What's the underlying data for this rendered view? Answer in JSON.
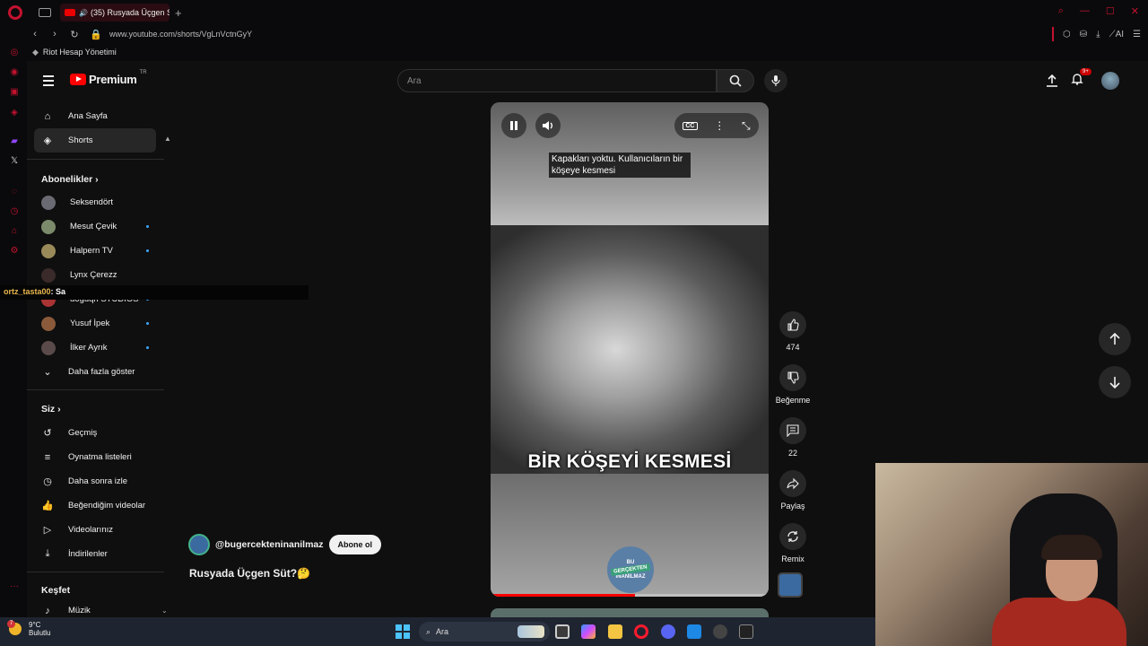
{
  "browser": {
    "tab_title": "(35) Rusyada Üçgen S",
    "url": "www.youtube.com/shorts/VgLnVctnGyY",
    "bookmark": "Riot Hesap Yönetimi",
    "ai_label": "AI"
  },
  "youtube": {
    "logo_text": "Premium",
    "logo_country": "TR",
    "search_placeholder": "Ara",
    "notification_count": "9+"
  },
  "sidebar": {
    "main": [
      {
        "label": "Ana Sayfa",
        "icon": "home-icon"
      },
      {
        "label": "Shorts",
        "icon": "shorts-icon",
        "active": true
      }
    ],
    "subscriptions_title": "Abonelikler",
    "subscriptions": [
      {
        "label": "Seksendört",
        "new": false
      },
      {
        "label": "Mesut Çevik",
        "new": true
      },
      {
        "label": "Halpern TV",
        "new": true
      },
      {
        "label": "Lynx Çerezz",
        "new": false
      },
      {
        "label": "doguqn STUDIOS",
        "new": true
      },
      {
        "label": "Yusuf İpek",
        "new": true
      },
      {
        "label": "İlker Ayrık",
        "new": true
      }
    ],
    "show_more": "Daha fazla göster",
    "you_title": "Siz",
    "you_items": [
      {
        "label": "Geçmiş",
        "icon": "history-icon"
      },
      {
        "label": "Oynatma listeleri",
        "icon": "playlist-icon"
      },
      {
        "label": "Daha sonra izle",
        "icon": "clock-icon"
      },
      {
        "label": "Beğendiğim videolar",
        "icon": "thumbs-up-icon"
      },
      {
        "label": "Videolarınız",
        "icon": "video-icon"
      },
      {
        "label": "İndirilenler",
        "icon": "download-icon"
      }
    ],
    "explore_title": "Keşfet",
    "explore_items": [
      {
        "label": "Müzik",
        "icon": "music-icon"
      }
    ]
  },
  "chat_overlay": {
    "user": "ortz_tasta00",
    "message": ": Sa"
  },
  "short": {
    "caption": "Kapakları yoktu. Kullanıcıların bir köşeye kesmesi",
    "big_subtitle": "BİR KÖŞEYİ KESMESİ",
    "watermark_top": "BU",
    "watermark_mid": "GERÇEKTEN",
    "watermark_bottom": "İNANILMAZ",
    "progress": 0.52,
    "channel_handle": "@bugercekteninanilmaz",
    "subscribe_label": "Abone ol",
    "title": "Rusyada Üçgen Süt?🤔",
    "cc_label": "CC"
  },
  "actions": {
    "likes": "474",
    "dislike_label": "Beğenme",
    "comments": "22",
    "share_label": "Paylaş",
    "remix_label": "Remix"
  },
  "taskbar": {
    "temperature": "9°C",
    "weather": "Bulutlu",
    "weather_alert": "7",
    "search_label": "Ara"
  },
  "colors": {
    "accent_red": "#ff0000",
    "opera_red": "#c4122f",
    "background": "#0f0f0f"
  }
}
